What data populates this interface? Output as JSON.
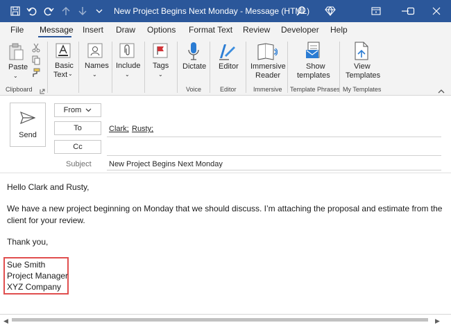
{
  "window": {
    "title": "New Project Begins Next Monday  -  Message (HTML)",
    "titlebar_color": "#2b579a"
  },
  "quick_access": [
    "save-icon",
    "undo-icon",
    "redo-icon",
    "up-arrow-icon",
    "down-arrow-icon",
    "customize-icon"
  ],
  "menu": {
    "tabs": [
      "File",
      "Message",
      "Insert",
      "Draw",
      "Options",
      "Format Text",
      "Review",
      "Developer",
      "Help"
    ],
    "active": "Message"
  },
  "ribbon": {
    "paste": "Paste",
    "basic_text_1": "Basic",
    "basic_text_2": "Text",
    "names": "Names",
    "include": "Include",
    "tags": "Tags",
    "dictate": "Dictate",
    "editor": "Editor",
    "immersive_1": "Immersive",
    "immersive_2": "Reader",
    "show_templates_1": "Show",
    "show_templates_2": "templates",
    "view_templates_1": "View",
    "view_templates_2": "Templates",
    "groups": {
      "clipboard": "Clipboard",
      "voice": "Voice",
      "editor": "Editor",
      "immersive": "Immersive",
      "template_phrases": "Template Phrases",
      "my_templates": "My Templates"
    }
  },
  "compose": {
    "send": "Send",
    "from": "From",
    "to": "To",
    "cc": "Cc",
    "recipient_1": "Clark;",
    "recipient_2": "Rusty;",
    "subject_label": "Subject",
    "subject_value": "New Project Begins Next Monday"
  },
  "message": {
    "greeting": "Hello Clark and Rusty,",
    "body_line_1": "We have a new project beginning on Monday that we should discuss. I’m attaching the proposal and estimate from the",
    "body_line_2": "client for your review.",
    "closing": "Thank you,",
    "signature": [
      "Sue Smith",
      "Project Manager",
      "XYZ Company"
    ],
    "signature_highlight_color": "#e04e4e"
  }
}
